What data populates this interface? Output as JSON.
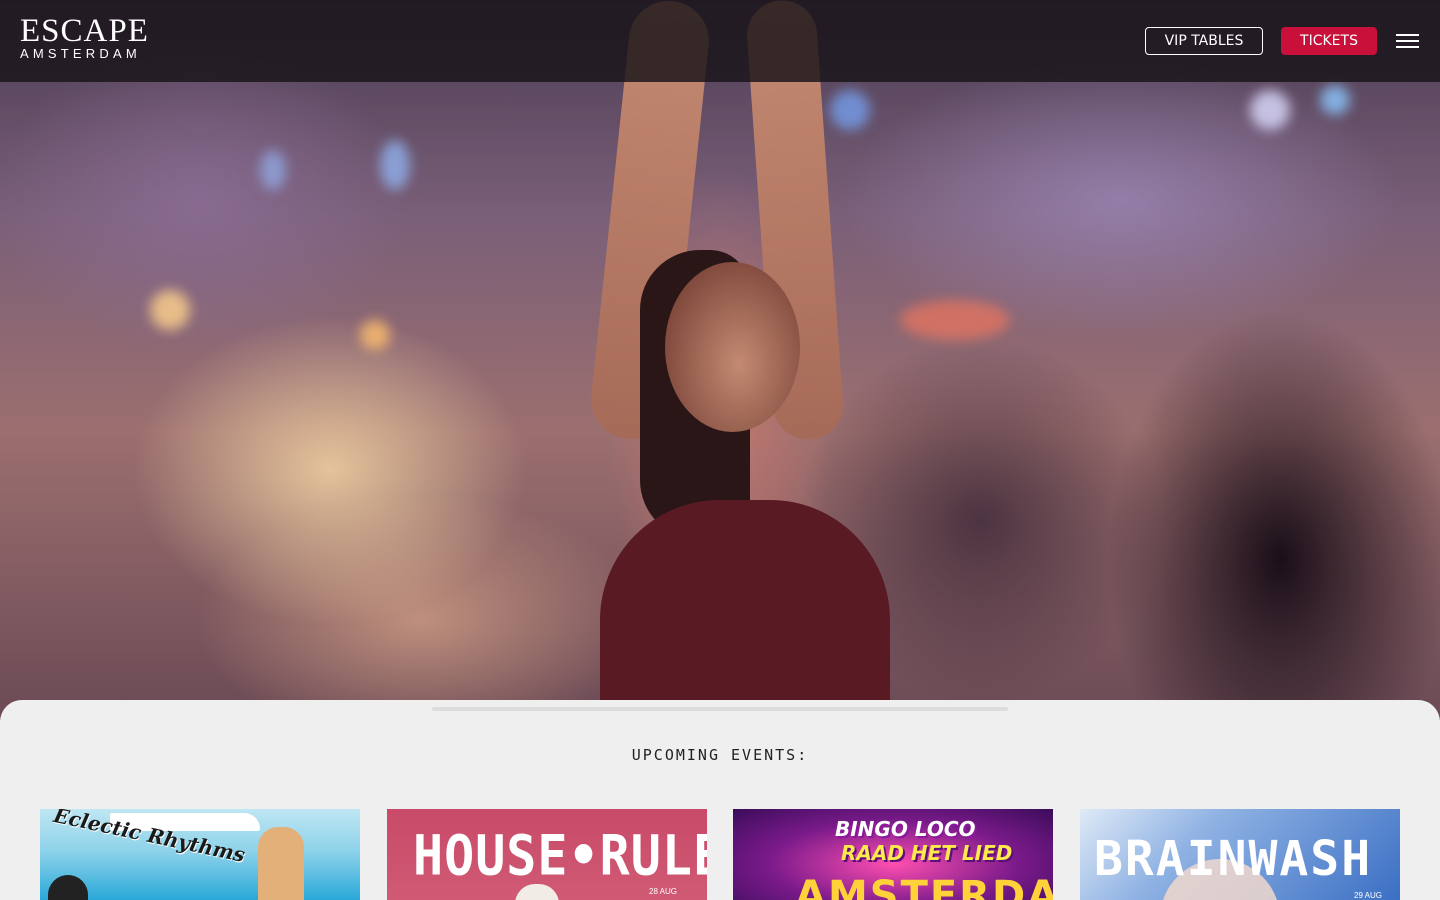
{
  "header": {
    "logo_main": "ESCAPE",
    "logo_sub": "AMSTERDAM",
    "vip_label": "VIP TABLES",
    "tickets_label": "TICKETS",
    "menu_icon": "hamburger-menu-icon",
    "accent_color": "#c8103a"
  },
  "hero": {
    "image": "club-crowd-photo"
  },
  "events": {
    "title": "UPCOMING EVENTS:",
    "cards": [
      {
        "title": "Eclectic Rhythms",
        "date": ""
      },
      {
        "title": "HOUSE•RULES",
        "date": "28 AUG"
      },
      {
        "title": "BINGO LOCO",
        "subtitle": "RAAD HET LIED",
        "city": "AMSTERDAM",
        "date": ""
      },
      {
        "title": "BRAINWASH",
        "date": "29 AUG"
      }
    ]
  }
}
